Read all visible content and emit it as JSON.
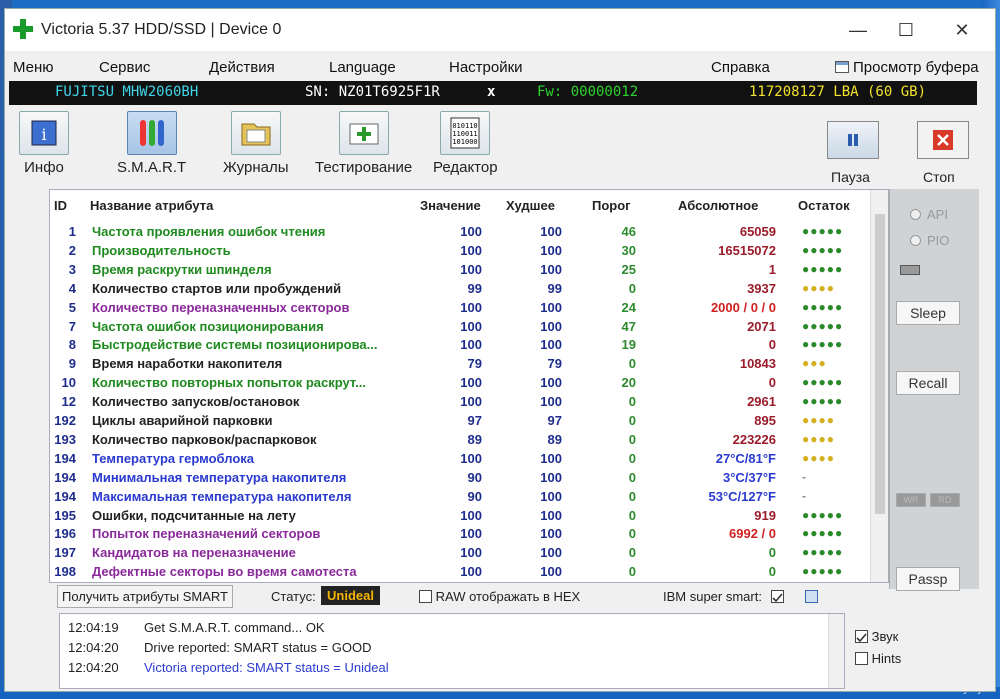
{
  "window": {
    "title": "Victoria 5.37 HDD/SSD | Device 0",
    "minimize": "—",
    "maximize": "☐",
    "close": "✕"
  },
  "menu": {
    "items": [
      "Меню",
      "Сервис",
      "Действия",
      "Language",
      "Настройки",
      "Справка"
    ],
    "buffer": "Просмотр буфера"
  },
  "device": {
    "model": "FUJITSU MHW2060BH",
    "sn": "SN: NZ01T6925F1R",
    "x": "x",
    "fw": "Fw: 00000012",
    "lba": "117208127 LBA (60 GB)"
  },
  "toolbar": {
    "info": "Инфо",
    "smart": "S.M.A.R.T",
    "journals": "Журналы",
    "testing": "Тестирование",
    "editor": "Редактор",
    "pause": "Пауза",
    "stop": "Стоп"
  },
  "table": {
    "headers": {
      "id": "ID",
      "name": "Название атрибута",
      "value": "Значение",
      "worst": "Худшее",
      "threshold": "Порог",
      "absolute": "Абсолютное",
      "remaining": "Остаток"
    },
    "rows": [
      {
        "id": "1",
        "name": "Частота проявления ошибок чтения",
        "value": "100",
        "worst": "100",
        "thr": "46",
        "abs": "65059",
        "dots": "●●●●●",
        "nameColor": "#1f8a1f",
        "absColor": "#9a1c2a",
        "dotColor": "#2a8a2a"
      },
      {
        "id": "2",
        "name": "Производительность",
        "value": "100",
        "worst": "100",
        "thr": "30",
        "abs": "16515072",
        "dots": "●●●●●",
        "nameColor": "#1f8a1f",
        "absColor": "#9a1c2a",
        "dotColor": "#2a8a2a"
      },
      {
        "id": "3",
        "name": "Время раскрутки шпинделя",
        "value": "100",
        "worst": "100",
        "thr": "25",
        "abs": "1",
        "dots": "●●●●●",
        "nameColor": "#1f8a1f",
        "absColor": "#9a1c2a",
        "dotColor": "#2a8a2a"
      },
      {
        "id": "4",
        "name": "Количество стартов или пробуждений",
        "value": "99",
        "worst": "99",
        "thr": "0",
        "abs": "3937",
        "dots": "●●●●",
        "nameColor": "#222222",
        "absColor": "#9a1c2a",
        "dotColor": "#d4b020"
      },
      {
        "id": "5",
        "name": "Количество переназначенных секторов",
        "value": "100",
        "worst": "100",
        "thr": "24",
        "abs": "2000 / 0 / 0",
        "dots": "●●●●●",
        "nameColor": "#8a2a9a",
        "absColor": "#d02020",
        "dotColor": "#2a8a2a"
      },
      {
        "id": "7",
        "name": "Частота ошибок позиционирования",
        "value": "100",
        "worst": "100",
        "thr": "47",
        "abs": "2071",
        "dots": "●●●●●",
        "nameColor": "#1f8a1f",
        "absColor": "#9a1c2a",
        "dotColor": "#2a8a2a"
      },
      {
        "id": "8",
        "name": "Быстродействие системы позиционирова...",
        "value": "100",
        "worst": "100",
        "thr": "19",
        "abs": "0",
        "dots": "●●●●●",
        "nameColor": "#1f8a1f",
        "absColor": "#9a1c2a",
        "dotColor": "#2a8a2a"
      },
      {
        "id": "9",
        "name": "Время наработки накопителя",
        "value": "79",
        "worst": "79",
        "thr": "0",
        "abs": "10843",
        "dots": "●●●",
        "nameColor": "#222222",
        "absColor": "#9a1c2a",
        "dotColor": "#d4b020"
      },
      {
        "id": "10",
        "name": "Количество повторных попыток раскрут...",
        "value": "100",
        "worst": "100",
        "thr": "20",
        "abs": "0",
        "dots": "●●●●●",
        "nameColor": "#1f8a1f",
        "absColor": "#9a1c2a",
        "dotColor": "#2a8a2a"
      },
      {
        "id": "12",
        "name": "Количество запусков/остановок",
        "value": "100",
        "worst": "100",
        "thr": "0",
        "abs": "2961",
        "dots": "●●●●●",
        "nameColor": "#222222",
        "absColor": "#9a1c2a",
        "dotColor": "#2a8a2a"
      },
      {
        "id": "192",
        "name": "Циклы аварийной парковки",
        "value": "97",
        "worst": "97",
        "thr": "0",
        "abs": "895",
        "dots": "●●●●",
        "nameColor": "#222222",
        "absColor": "#9a1c2a",
        "dotColor": "#d4b020"
      },
      {
        "id": "193",
        "name": "Количество парковок/распарковок",
        "value": "89",
        "worst": "89",
        "thr": "0",
        "abs": "223226",
        "dots": "●●●●",
        "nameColor": "#222222",
        "absColor": "#9a1c2a",
        "dotColor": "#d4b020"
      },
      {
        "id": "194",
        "name": "Температура гермоблока",
        "value": "100",
        "worst": "100",
        "thr": "0",
        "abs": "27°C/81°F",
        "dots": "●●●●",
        "nameColor": "#2a3ad0",
        "absColor": "#2a3ad0",
        "dotColor": "#d4b020"
      },
      {
        "id": "194",
        "name": "Минимальная температура накопителя",
        "value": "90",
        "worst": "100",
        "thr": "0",
        "abs": "3°C/37°F",
        "dots": "-",
        "nameColor": "#2a3ad0",
        "absColor": "#2a3ad0",
        "dotColor": "#888888"
      },
      {
        "id": "194",
        "name": "Максимальная температура накопителя",
        "value": "90",
        "worst": "100",
        "thr": "0",
        "abs": "53°C/127°F",
        "dots": "-",
        "nameColor": "#2a3ad0",
        "absColor": "#2a3ad0",
        "dotColor": "#888888"
      },
      {
        "id": "195",
        "name": "Ошибки, подсчитанные на лету",
        "value": "100",
        "worst": "100",
        "thr": "0",
        "abs": "919",
        "dots": "●●●●●",
        "nameColor": "#222222",
        "absColor": "#9a1c2a",
        "dotColor": "#2a8a2a"
      },
      {
        "id": "196",
        "name": "Попыток переназначений секторов",
        "value": "100",
        "worst": "100",
        "thr": "0",
        "abs": "6992 / 0",
        "dots": "●●●●●",
        "nameColor": "#8a2a9a",
        "absColor": "#d02020",
        "dotColor": "#2a8a2a"
      },
      {
        "id": "197",
        "name": "Кандидатов на переназначение",
        "value": "100",
        "worst": "100",
        "thr": "0",
        "abs": "0",
        "dots": "●●●●●",
        "nameColor": "#8a2a9a",
        "absColor": "#2a8a2a",
        "dotColor": "#2a8a2a"
      },
      {
        "id": "198",
        "name": "Дефектные секторы во время самотеста",
        "value": "100",
        "worst": "100",
        "thr": "0",
        "abs": "0",
        "dots": "●●●●●",
        "nameColor": "#8a2a9a",
        "absColor": "#2a8a2a",
        "dotColor": "#2a8a2a"
      }
    ]
  },
  "bottom": {
    "get_smart": "Получить атрибуты SMART",
    "status_label": "Статус:",
    "status_value": "Unideal",
    "raw_hex": "RAW отображать в HEX",
    "ibm": "IBM super smart:"
  },
  "log": [
    {
      "time": "12:04:19",
      "msg": "Get S.M.A.R.T. command... OK",
      "color": "#222222"
    },
    {
      "time": "12:04:20",
      "msg": "Drive reported: SMART status = GOOD",
      "color": "#222222"
    },
    {
      "time": "12:04:20",
      "msg": "Victoria reported: SMART status = Unideal",
      "color": "#2a3ad0"
    }
  ],
  "side": {
    "api": "API",
    "pio": "PIO",
    "sleep": "Sleep",
    "recall": "Recall",
    "wr": "WR",
    "rd": "RD",
    "passp": "Passp",
    "sound": "Звук",
    "hints": "Hints"
  },
  "colors": {
    "model": "#3fd4e8",
    "sn": "#ffffff",
    "fw": "#2ed12e",
    "lba": "#f2e22a"
  },
  "desktop": {
    "watermark": "www.ay.by"
  }
}
